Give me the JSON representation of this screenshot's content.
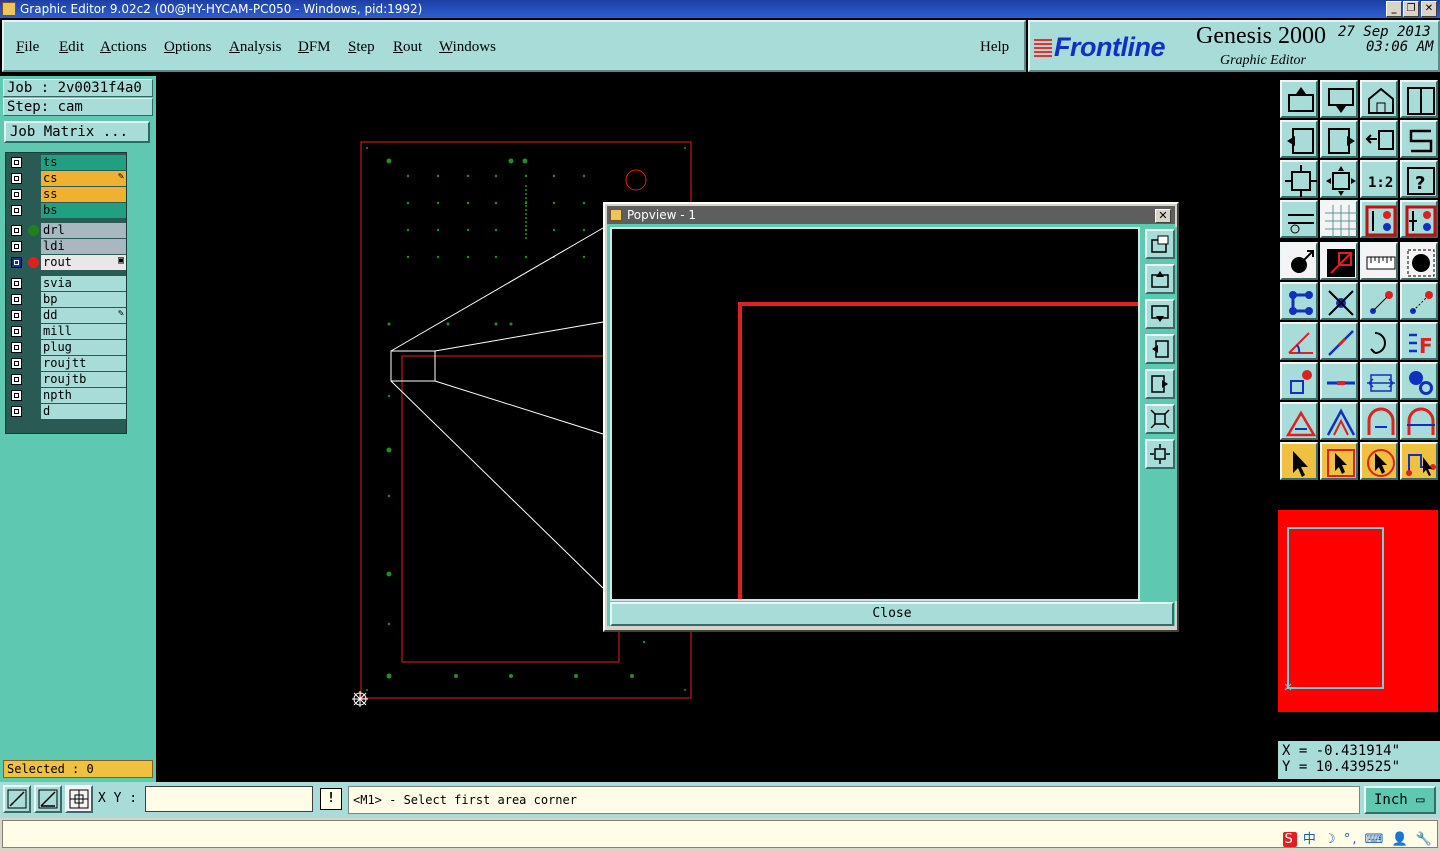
{
  "window": {
    "title": "Graphic Editor 9.02c2 (00@HY-HYCAM-PC050 - Windows, pid:1992)",
    "min_label": "_",
    "restore_label": "❐",
    "close_label": "✕"
  },
  "menubar": {
    "items": [
      {
        "key": "F",
        "rest": "ile"
      },
      {
        "key": "E",
        "rest": "dit"
      },
      {
        "key": "A",
        "rest": "ctions"
      },
      {
        "key": "O",
        "rest": "ptions"
      },
      {
        "key": "A",
        "rest": "nalysis"
      },
      {
        "key": "D",
        "rest": "FM"
      },
      {
        "key": "S",
        "rest": "tep"
      },
      {
        "key": "R",
        "rest": "out"
      },
      {
        "key": "W",
        "rest": "indows"
      }
    ],
    "help": "Help"
  },
  "brand": {
    "logo": "Frontline",
    "product": "Genesis 2000",
    "subtitle": "Graphic Editor",
    "date": "27 Sep 2013",
    "time": "03:06 AM"
  },
  "job": {
    "job_label": "Job : 2v0031f4a0",
    "step_label": "Step: cam",
    "matrix_button": "Job Matrix ..."
  },
  "layers": [
    {
      "name": "ts",
      "color": "#20a080",
      "dot": "",
      "mark": ""
    },
    {
      "name": "cs",
      "color": "#f0b030",
      "dot": "",
      "mark": "✎"
    },
    {
      "name": "ss",
      "color": "#f0b030",
      "dot": "",
      "mark": ""
    },
    {
      "name": "bs",
      "color": "#20a080",
      "dot": "",
      "mark": ""
    },
    {
      "name": "drl",
      "color": "#a8b8c0",
      "dot": "#208020",
      "mark": ""
    },
    {
      "name": "ldi",
      "color": "#a8b8c0",
      "dot": "",
      "mark": ""
    },
    {
      "name": "rout",
      "color": "#e8e8e8",
      "dot": "#e02020",
      "mark": "▣",
      "active": true
    },
    {
      "name": "svia",
      "color": "#a8dcd8",
      "dot": "",
      "mark": ""
    },
    {
      "name": "bp",
      "color": "#a8dcd8",
      "dot": "",
      "mark": ""
    },
    {
      "name": "dd",
      "color": "#a8dcd8",
      "dot": "",
      "mark": "✎"
    },
    {
      "name": "mill",
      "color": "#a8dcd8",
      "dot": "",
      "mark": ""
    },
    {
      "name": "plug",
      "color": "#a8dcd8",
      "dot": "",
      "mark": ""
    },
    {
      "name": "roujtt",
      "color": "#a8dcd8",
      "dot": "",
      "mark": ""
    },
    {
      "name": "roujtb",
      "color": "#a8dcd8",
      "dot": "",
      "mark": ""
    },
    {
      "name": "npth",
      "color": "#a8dcd8",
      "dot": "",
      "mark": ""
    },
    {
      "name": "d",
      "color": "#a8dcd8",
      "dot": "",
      "mark": ""
    }
  ],
  "selection": {
    "label": "Selected : 0"
  },
  "popview": {
    "title": "Popview - 1",
    "close_button": "Close",
    "close_x": "✕"
  },
  "toolbar_icons": [
    "zoom-home-icon",
    "zoom-down-icon",
    "home-icon",
    "split-view-icon",
    "pan-left-icon",
    "pan-right-icon",
    "undo-zoom-icon",
    "snake-route-icon",
    "fit-screen-icon",
    "center-icon",
    "scale-1-2-icon",
    "help-icon",
    "tools-icon",
    "grid-icon",
    "layer-compare-icon",
    "layer-compare-2-icon",
    "feature-add-icon",
    "select-red-icon",
    "ruler-icon",
    "pad-icon",
    "connect-icon",
    "delete-feature-icon",
    "move-point-icon",
    "move-point-2-icon",
    "angle-icon",
    "line-edit-icon",
    "arc-icon",
    "text-f-icon",
    "pad-move-icon",
    "split-line-icon",
    "measure-icon",
    "cluster-icon",
    "triangle-select-icon",
    "triangle-outline-icon",
    "arch-icon",
    "arch-cross-icon",
    "pointer-icon",
    "pointer-box-icon",
    "pointer-circle-icon",
    "pointer-route-icon"
  ],
  "coords": {
    "x": "X = -0.431914\"",
    "y": "Y = 10.439525\""
  },
  "bottom": {
    "xy_label": "X Y :",
    "xy_value": "",
    "excl": "!",
    "prompt": "<M1> - Select first area corner",
    "unit": "Inch ▭"
  },
  "tray": {
    "ime": "S",
    "text": "中 ☽ °, ⌨ 👤 🔧"
  }
}
